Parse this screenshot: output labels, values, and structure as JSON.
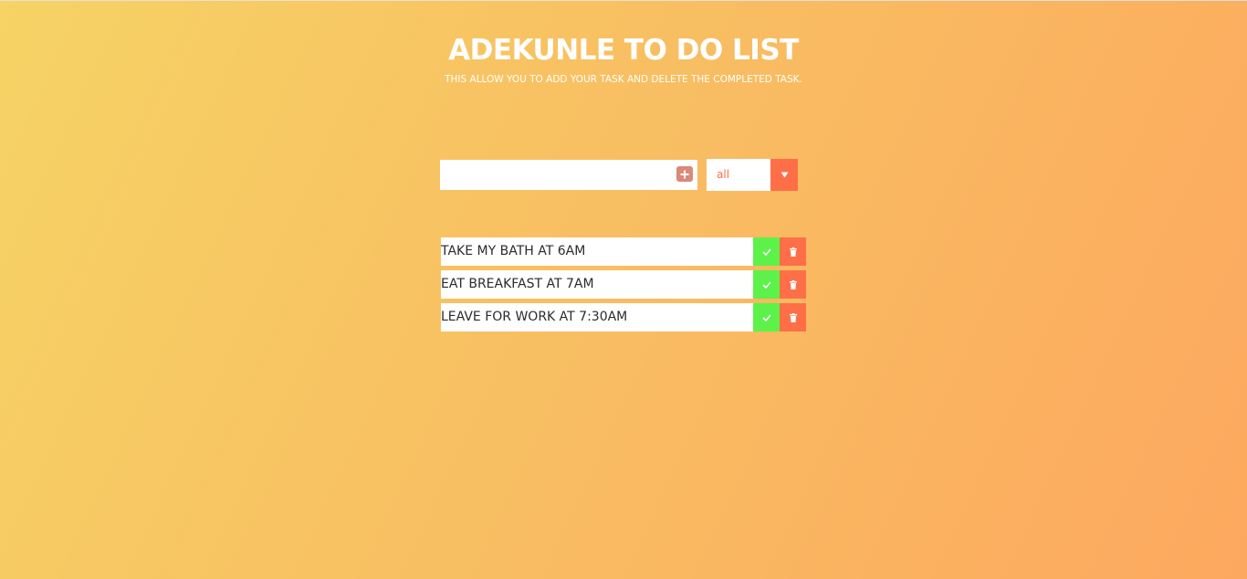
{
  "header": {
    "title": "ADEKUNLE TO DO LIST",
    "subtitle": "THIS ALLOW YOU TO ADD YOUR TASK AND DELETE THE COMPLETED TASK."
  },
  "form": {
    "input_value": "",
    "add_icon": "plus-square-icon",
    "filter_selected": "all",
    "filter_arrow_icon": "caret-down-icon"
  },
  "todos": [
    {
      "text": "TAKE MY BATH AT 6AM"
    },
    {
      "text": "EAT BREAKFAST AT 7AM"
    },
    {
      "text": "LEAVE FOR WORK AT 7:30AM"
    }
  ],
  "icons": {
    "complete": "check-icon",
    "delete": "trash-icon"
  },
  "colors": {
    "gradient_start": "#f6d365",
    "gradient_end": "#fda085",
    "accent": "#ff6f47",
    "complete": "#5cf249",
    "add_button": "#d98a78"
  }
}
